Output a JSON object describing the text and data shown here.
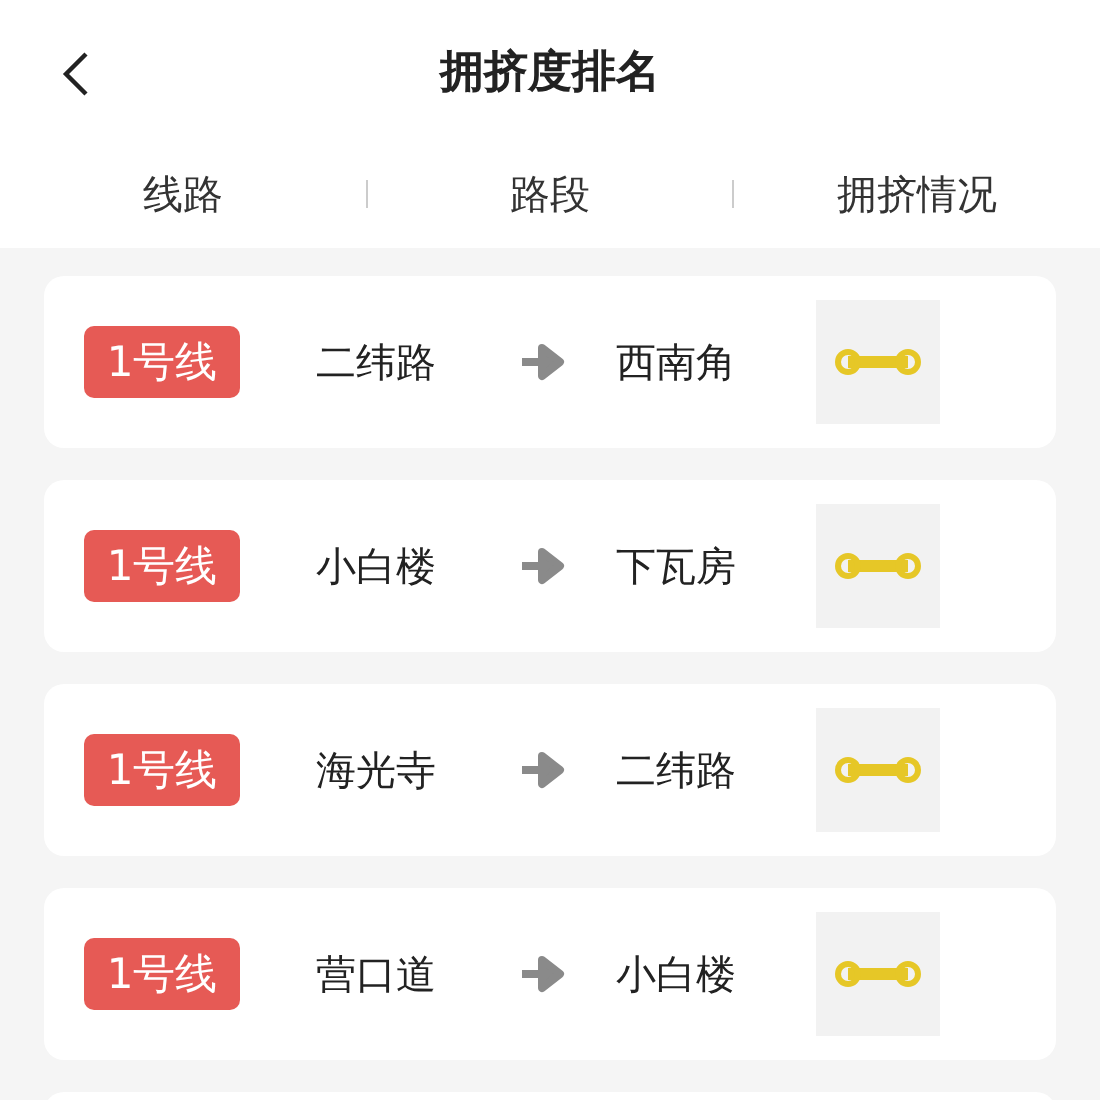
{
  "header": {
    "title": "拥挤度排名"
  },
  "columns": [
    "线路",
    "路段",
    "拥挤情况"
  ],
  "rows": [
    {
      "line": "1号线",
      "from": "二纬路",
      "to": "西南角"
    },
    {
      "line": "1号线",
      "from": "小白楼",
      "to": "下瓦房"
    },
    {
      "line": "1号线",
      "from": "海光寺",
      "to": "二纬路"
    },
    {
      "line": "1号线",
      "from": "营口道",
      "to": "小白楼"
    }
  ]
}
